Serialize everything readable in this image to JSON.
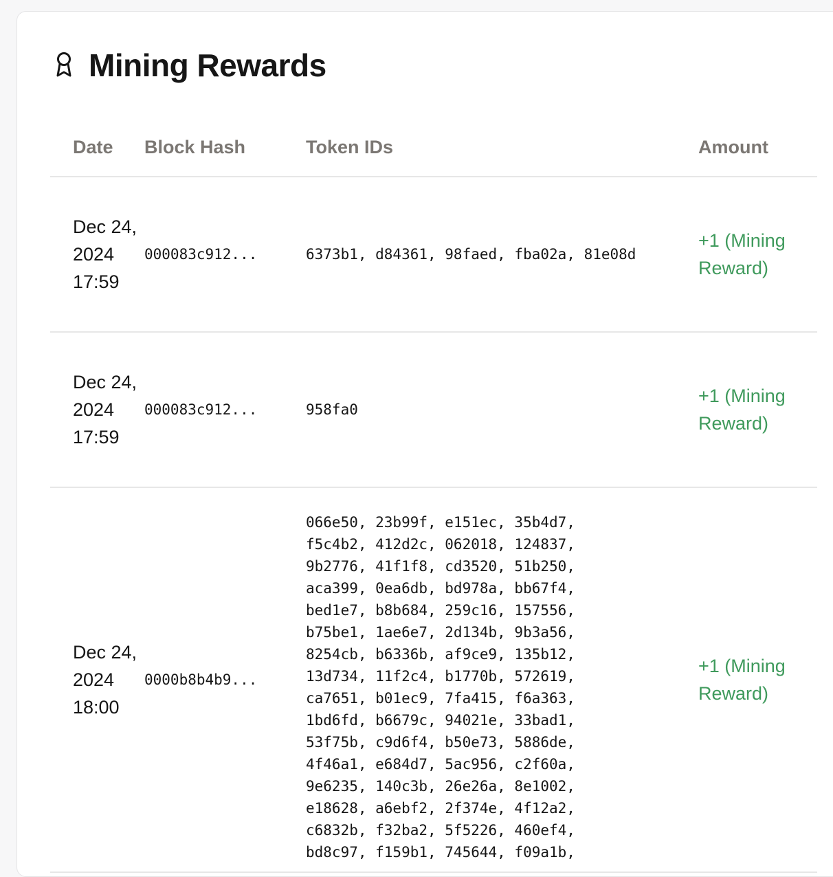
{
  "panel": {
    "title": "Mining Rewards",
    "icon": "award-ribbon-icon"
  },
  "table": {
    "headers": {
      "date": "Date",
      "block_hash": "Block Hash",
      "token_ids": "Token IDs",
      "amount": "Amount"
    },
    "rows": [
      {
        "date": "Dec 24, 2024 17:59",
        "block_hash": "000083c912...",
        "token_ids": "6373b1, d84361, 98faed, fba02a, 81e08d",
        "amount": "+1 (Mining Reward)"
      },
      {
        "date": "Dec 24, 2024 17:59",
        "block_hash": "000083c912...",
        "token_ids": "958fa0",
        "amount": "+1 (Mining Reward)"
      },
      {
        "date": "Dec 24, 2024 18:00",
        "block_hash": "0000b8b4b9...",
        "token_ids": "066e50, 23b99f, e151ec, 35b4d7,\nf5c4b2, 412d2c, 062018, 124837,\n9b2776, 41f1f8, cd3520, 51b250,\naca399, 0ea6db, bd978a, bb67f4,\nbed1e7, b8b684, 259c16, 157556,\nb75be1, 1ae6e7, 2d134b, 9b3a56,\n8254cb, b6336b, af9ce9, 135b12,\n13d734, 11f2c4, b1770b, 572619,\nca7651, b01ec9, 7fa415, f6a363,\n1bd6fd, b6679c, 94021e, 33bad1,\n53f75b, c9d6f4, b50e73, 5886de,\n4f46a1, e684d7, 5ac956, c2f60a,\n9e6235, 140c3b, 26e26a, 8e1002,\ne18628, a6ebf2, 2f374e, 4f12a2,\nc6832b, f32ba2, 5f5226, 460ef4,\nbd8c97, f159b1, 745644, f09a1b,",
        "amount": "+1 (Mining Reward)"
      }
    ]
  },
  "colors": {
    "header_text": "#7b7773",
    "amount_green": "#3f9a5c",
    "divider": "#e7e7e7"
  }
}
